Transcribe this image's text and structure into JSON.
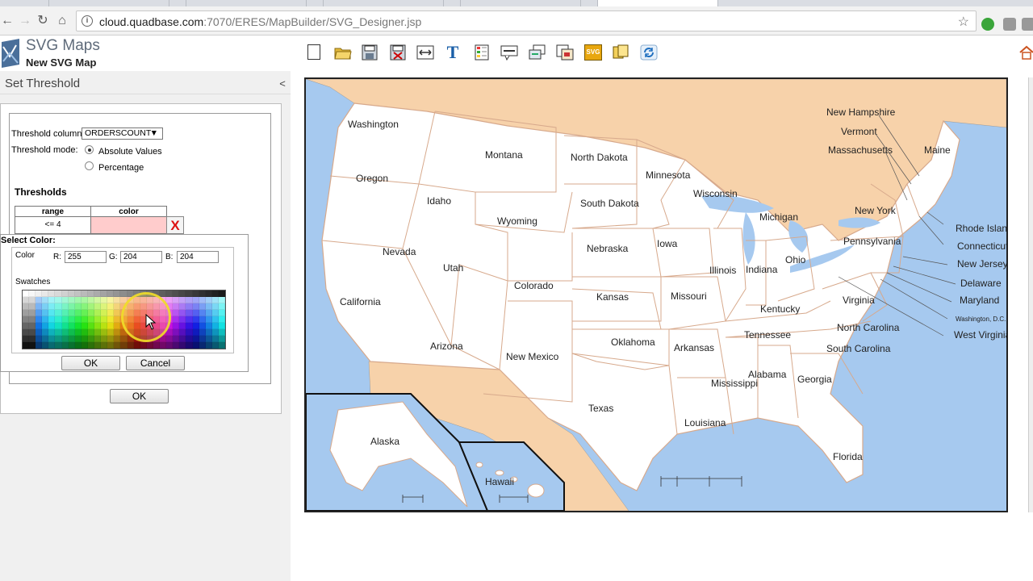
{
  "browser": {
    "url_host": "cloud.quadbase.com",
    "url_rest": ":7070/ERES/MapBuilder/SVG_Designer.jsp",
    "icons": [
      "back-icon",
      "forward-icon",
      "reload-icon",
      "info-icon",
      "star-icon"
    ]
  },
  "app": {
    "title": "SVG Maps",
    "subtitle": "New SVG Map"
  },
  "panel": {
    "title": "Set Threshold",
    "collapse": "<",
    "threshold_column_label": "Threshold column:",
    "threshold_column_value": "ORDERSCOUNT",
    "threshold_mode_label": "Threshold mode:",
    "mode_absolute": "Absolute Values",
    "mode_percentage": "Percentage",
    "thresholds_heading": "Thresholds",
    "table_headers": [
      "range",
      "color"
    ],
    "rows": [
      {
        "range": "<= 4",
        "color": "#ffcccc"
      }
    ],
    "delete_label": "X",
    "ok_label": "OK"
  },
  "picker": {
    "title": "Select Color:",
    "color_label": "Color",
    "r_label": "R:",
    "g_label": "G:",
    "b_label": "B:",
    "r": "255",
    "g": "204",
    "b": "204",
    "swatches_label": "Swatches",
    "ok_label": "OK",
    "cancel_label": "Cancel"
  },
  "toolbar": {
    "icons": [
      "new-page-icon",
      "open-folder-icon",
      "save-icon",
      "save-as-icon",
      "resize-icon",
      "text-icon",
      "legend-icon",
      "tooltip-icon",
      "layers-icon",
      "properties-icon",
      "svg-export-icon",
      "copy-icon",
      "refresh-icon"
    ],
    "text_glyph": "T",
    "svg_glyph": "SVG"
  },
  "map": {
    "states": [
      "Washington",
      "Oregon",
      "California",
      "Idaho",
      "Nevada",
      "Montana",
      "Wyoming",
      "Utah",
      "Arizona",
      "Colorado",
      "New Mexico",
      "North Dakota",
      "South Dakota",
      "Nebraska",
      "Kansas",
      "Oklahoma",
      "Texas",
      "Minnesota",
      "Iowa",
      "Missouri",
      "Arkansas",
      "Louisiana",
      "Wisconsin",
      "Illinois",
      "Mississippi",
      "Michigan",
      "Indiana",
      "Kentucky",
      "Tennessee",
      "Alabama",
      "Ohio",
      "Georgia",
      "Florida",
      "South Carolina",
      "North Carolina",
      "Virginia",
      "West Virginia",
      "Pennsylvania",
      "New York",
      "Maine",
      "New Hampshire",
      "Vermont",
      "Massachusetts",
      "Rhode Island",
      "Connecticut",
      "New Jersey",
      "Delaware",
      "Maryland",
      "Washington, D.C.",
      "Alaska",
      "Hawaii"
    ],
    "colors": {
      "ocean": "#a6c9ef",
      "land_foreign": "#f7d2aa",
      "state_fill": "#ffffff",
      "state_border": "#d7a98c"
    }
  }
}
